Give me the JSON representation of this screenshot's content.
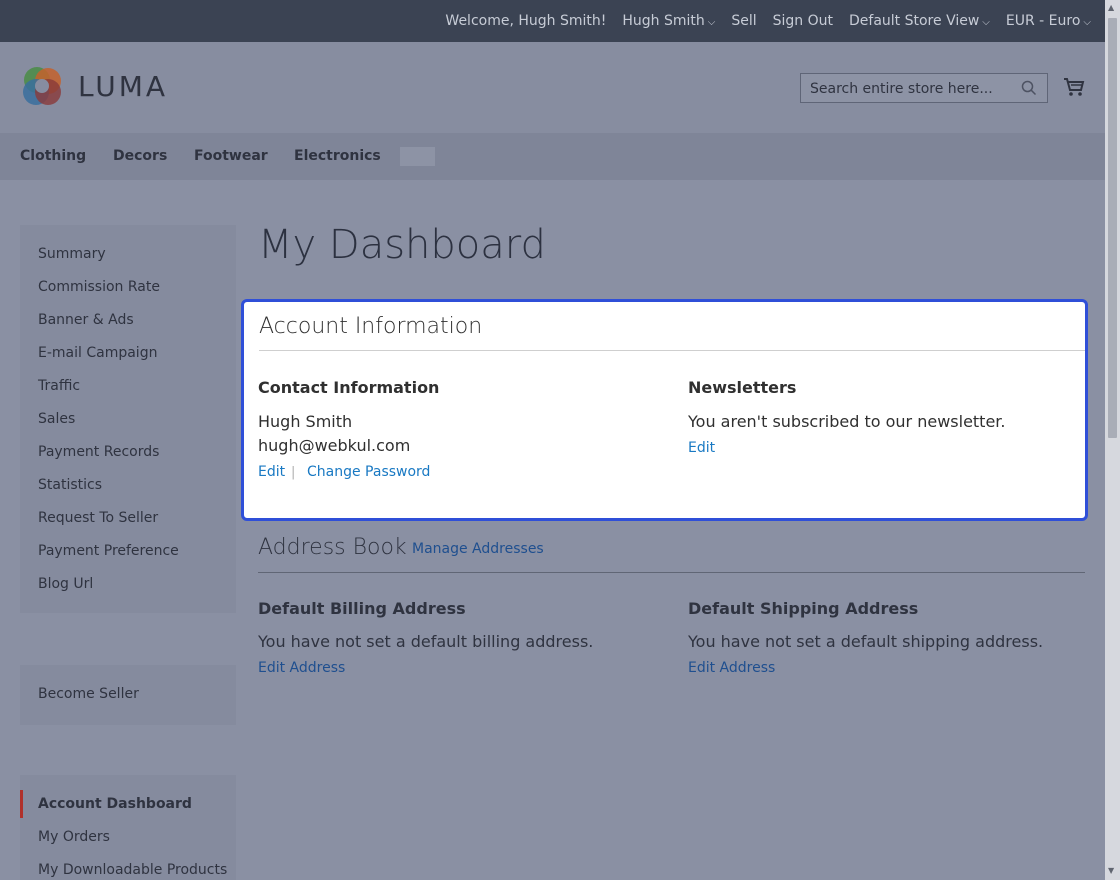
{
  "topbar": {
    "welcome": "Welcome, Hugh Smith!",
    "account": "Hugh Smith",
    "sell": "Sell",
    "sign_out": "Sign Out",
    "store_view": "Default Store View",
    "currency": "EUR - Euro"
  },
  "header": {
    "logo_text": "LUMA",
    "search_placeholder": "Search entire store here..."
  },
  "nav": {
    "items": [
      "Clothing",
      "Decors",
      "Footwear",
      "Electronics"
    ]
  },
  "sidebar": {
    "seller_menu": [
      "Summary",
      "Commission Rate",
      "Banner & Ads",
      "E-mail Campaign",
      "Traffic",
      "Sales",
      "Payment Records",
      "Statistics",
      "Request To Seller",
      "Payment Preference",
      "Blog Url"
    ],
    "become_seller": "Become Seller",
    "account_menu": [
      "Account Dashboard",
      "My Orders",
      "My Downloadable Products"
    ]
  },
  "main": {
    "title": "My Dashboard",
    "account_info": {
      "heading": "Account Information",
      "contact_title": "Contact Information",
      "name": "Hugh Smith",
      "email": "hugh@webkul.com",
      "edit": "Edit",
      "separator": "|",
      "change_password": "Change Password",
      "newsletters_title": "Newsletters",
      "newsletters_text": "You aren't subscribed to our newsletter.",
      "newsletters_edit": "Edit"
    },
    "address_book": {
      "heading": "Address Book",
      "manage": "Manage Addresses",
      "billing_title": "Default Billing Address",
      "billing_text": "You have not set a default billing address.",
      "billing_edit": "Edit Address",
      "shipping_title": "Default Shipping Address",
      "shipping_text": "You have not set a default shipping address.",
      "shipping_edit": "Edit Address"
    }
  },
  "colors": {
    "link": "#1979c3",
    "highlight_border": "#2f4fd8",
    "active_marker": "#b0312b"
  }
}
